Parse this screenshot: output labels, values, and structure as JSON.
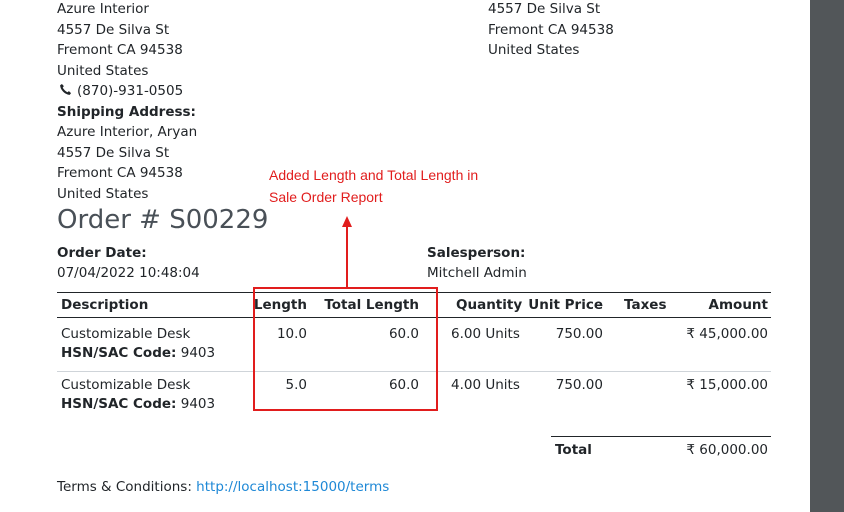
{
  "billing_address": {
    "name": "Azure Interior",
    "street": "4557 De Silva St",
    "city": "Fremont CA 94538",
    "country": "United States",
    "phone": "(870)-931-0505"
  },
  "shipping": {
    "label": "Shipping Address:",
    "name": "Azure Interior, Aryan",
    "street": "4557 De Silva St",
    "city": "Fremont CA 94538",
    "country": "United States"
  },
  "company_address": {
    "street": "4557 De Silva St",
    "city": "Fremont CA 94538",
    "country": "United States"
  },
  "annotation": {
    "line1": "Added Length and Total Length in",
    "line2": "Sale Order Report"
  },
  "order": {
    "title": "Order # S00229",
    "date_label": "Order Date:",
    "date_value": "07/04/2022 10:48:04",
    "salesperson_label": "Salesperson:",
    "salesperson_value": "Mitchell Admin"
  },
  "table": {
    "headers": {
      "description": "Description",
      "length": "Length",
      "total_length": "Total Length",
      "quantity": "Quantity",
      "unit_price": "Unit Price",
      "taxes": "Taxes",
      "amount": "Amount"
    },
    "rows": [
      {
        "product": "Customizable Desk",
        "hsn_label": "HSN/SAC Code:",
        "hsn_value": " 9403",
        "length": "10.0",
        "total_length": "60.0",
        "quantity": "6.00 Units",
        "unit_price": "750.00",
        "taxes": "",
        "amount": "₹ 45,000.00"
      },
      {
        "product": "Customizable Desk",
        "hsn_label": "HSN/SAC Code:",
        "hsn_value": " 9403",
        "length": "5.0",
        "total_length": "60.0",
        "quantity": "4.00 Units",
        "unit_price": "750.00",
        "taxes": "",
        "amount": "₹ 15,000.00"
      }
    ]
  },
  "total": {
    "label": "Total",
    "value": "₹ 60,000.00"
  },
  "terms": {
    "label": "Terms & Conditions: ",
    "link": "http://localhost:15000/terms"
  },
  "colors": {
    "annotation_red": "#e11d1d",
    "link_blue": "#1e88d6",
    "viewer_background": "#525659"
  }
}
